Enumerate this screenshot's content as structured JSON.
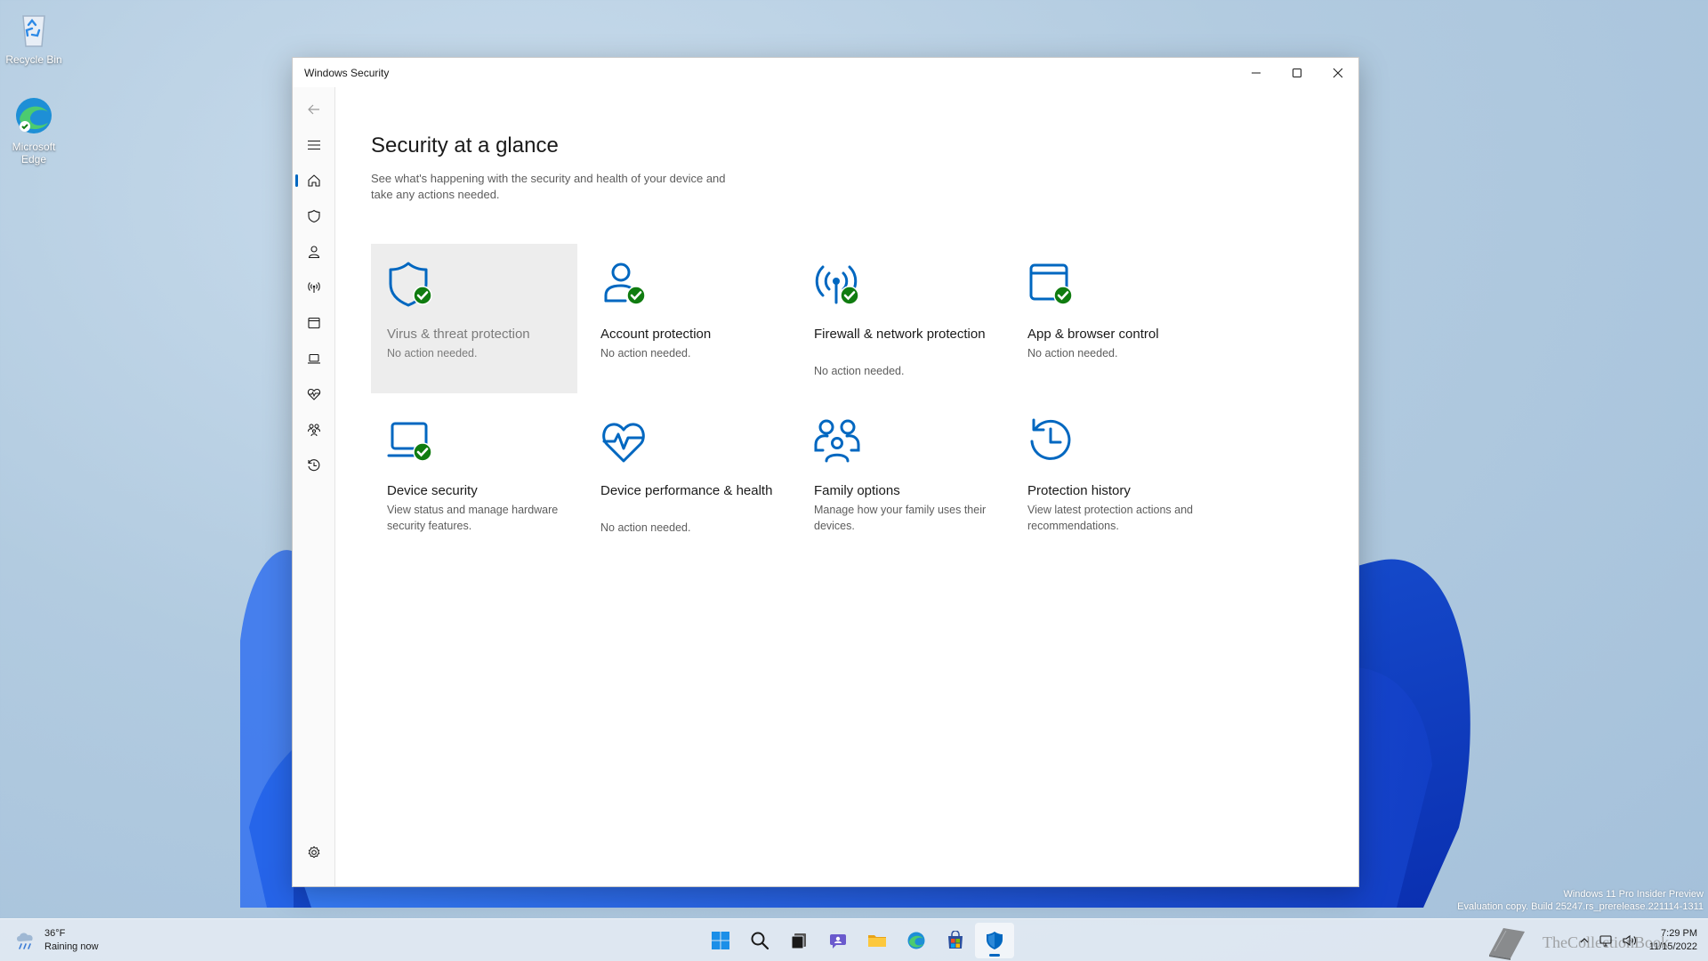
{
  "desktop": {
    "icons": [
      {
        "label": "Recycle Bin"
      },
      {
        "label": "Microsoft Edge"
      }
    ],
    "watermark": {
      "line1": "Windows 11 Pro Insider Preview",
      "line2": "Evaluation copy. Build 25247.rs_prerelease.221114-1311"
    }
  },
  "window": {
    "title": "Windows Security",
    "controls": [
      "minimize-icon",
      "maximize-icon",
      "close-icon"
    ]
  },
  "nav": {
    "items": [
      {
        "name": "back",
        "icon": "back-arrow-icon"
      },
      {
        "name": "menu",
        "icon": "hamburger-icon"
      },
      {
        "name": "home",
        "icon": "home-icon",
        "active": true
      },
      {
        "name": "virus",
        "icon": "shield-icon"
      },
      {
        "name": "account",
        "icon": "person-icon"
      },
      {
        "name": "firewall",
        "icon": "antenna-icon"
      },
      {
        "name": "app-browser",
        "icon": "browser-window-icon"
      },
      {
        "name": "device-security",
        "icon": "laptop-icon"
      },
      {
        "name": "device-performance",
        "icon": "heart-pulse-icon"
      },
      {
        "name": "family",
        "icon": "family-icon"
      },
      {
        "name": "history",
        "icon": "history-icon"
      },
      {
        "name": "settings",
        "icon": "gear-icon"
      }
    ]
  },
  "main": {
    "title": "Security at a glance",
    "description": "See what's happening with the security and health of your device and take any actions needed.",
    "tiles": [
      {
        "title": "Virus & threat protection",
        "subtitle": "No action needed.",
        "icon": "shield-check-icon",
        "status": "ok"
      },
      {
        "title": "Account protection",
        "subtitle": "No action needed.",
        "icon": "person-check-icon",
        "status": "ok"
      },
      {
        "title": "Firewall & network protection",
        "subtitle": "No action needed.",
        "icon": "antenna-check-icon",
        "status": "ok"
      },
      {
        "title": "App & browser control",
        "subtitle": "No action needed.",
        "icon": "browser-check-icon",
        "status": "ok"
      },
      {
        "title": "Device security",
        "subtitle": "View status and manage hardware security features.",
        "icon": "laptop-check-icon",
        "status": "ok"
      },
      {
        "title": "Device performance & health",
        "subtitle": "No action needed.",
        "icon": "heart-pulse-icon",
        "status": "none"
      },
      {
        "title": "Family options",
        "subtitle": "Manage how your family uses their devices.",
        "icon": "family-icon",
        "status": "none"
      },
      {
        "title": "Protection history",
        "subtitle": "View latest protection actions and recommendations.",
        "icon": "history-icon",
        "status": "none"
      }
    ]
  },
  "taskbar": {
    "weather": {
      "temp": "36°F",
      "condition": "Raining now"
    },
    "apps": [
      "start-icon",
      "search-icon",
      "task-view-icon",
      "chat-icon",
      "file-explorer-icon",
      "edge-icon",
      "store-icon",
      "windows-security-icon"
    ],
    "brand": "TheCollectionBook",
    "clock": {
      "time": "7:29 PM",
      "date": "11/15/2022"
    }
  },
  "colors": {
    "accent": "#0067c0",
    "ok_badge": "#107c10",
    "icon_blue": "#0067c0"
  }
}
